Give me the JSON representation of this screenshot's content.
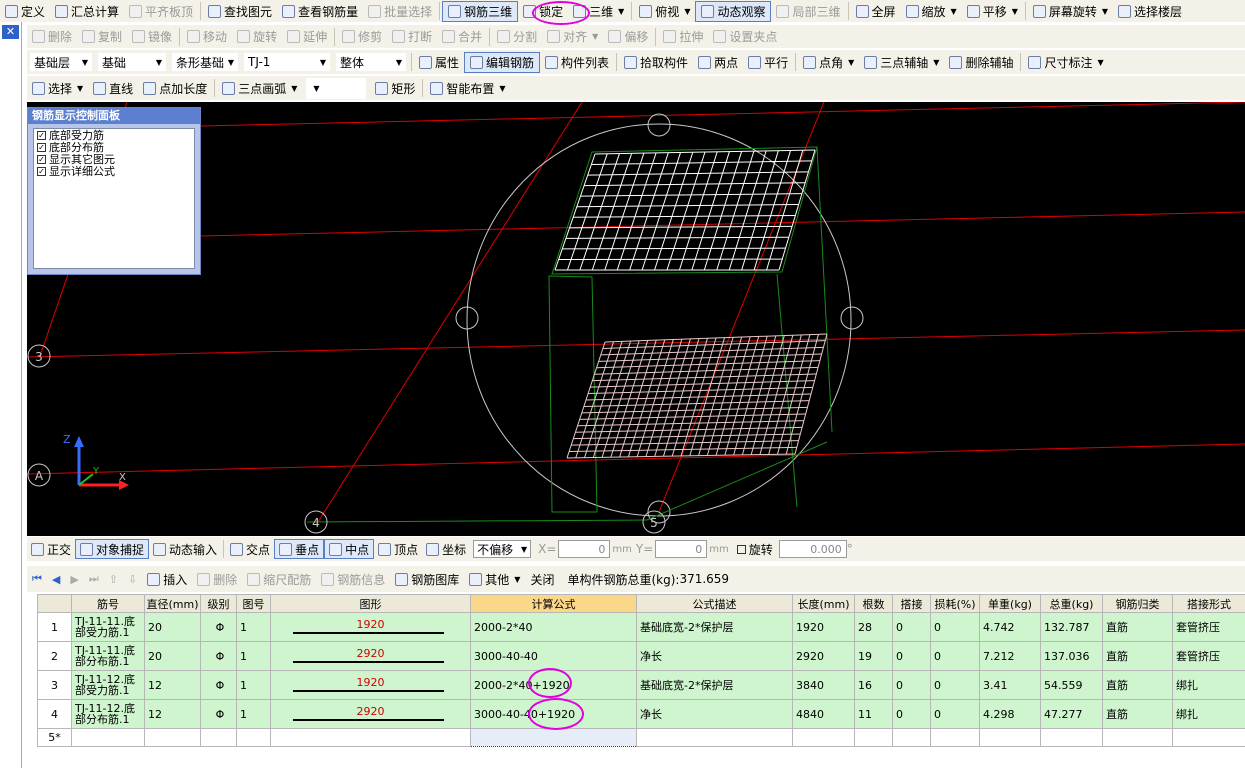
{
  "toolbar1": {
    "items": [
      {
        "label": "定义",
        "icon": "define-icon",
        "disabled": false
      },
      {
        "label": "汇总计算",
        "icon": "sum-icon",
        "disabled": false
      },
      {
        "label": "平齐板顶",
        "icon": "align-slab-icon",
        "disabled": true
      },
      {
        "label": "查找图元",
        "icon": "binoculars-icon",
        "disabled": false
      },
      {
        "label": "查看钢筋量",
        "icon": "view-rebar-icon",
        "disabled": false
      },
      {
        "label": "批量选择",
        "icon": "batch-select-icon",
        "disabled": true
      },
      {
        "label": "钢筋三维",
        "icon": "rebar-3d-icon",
        "disabled": false,
        "active": true
      },
      {
        "label": "锁定",
        "icon": "lock-icon",
        "disabled": false
      },
      {
        "label": "三维",
        "icon": "cube-icon",
        "disabled": false,
        "dropdown": true
      },
      {
        "label": "俯视",
        "icon": "top-view-icon",
        "disabled": false,
        "dropdown": true
      },
      {
        "label": "动态观察",
        "icon": "orbit-icon",
        "disabled": false,
        "active": true
      },
      {
        "label": "局部三维",
        "icon": "local-3d-icon",
        "disabled": true
      },
      {
        "label": "全屏",
        "icon": "fullscreen-icon",
        "disabled": false
      },
      {
        "label": "缩放",
        "icon": "zoom-icon",
        "disabled": false,
        "dropdown": true
      },
      {
        "label": "平移",
        "icon": "pan-icon",
        "disabled": false,
        "dropdown": true
      },
      {
        "label": "屏幕旋转",
        "icon": "screen-rotate-icon",
        "disabled": false,
        "dropdown": true
      },
      {
        "label": "选择楼层",
        "icon": "select-floor-icon",
        "disabled": false
      }
    ]
  },
  "toolbar2": {
    "items": [
      {
        "label": "删除",
        "icon": "delete-icon"
      },
      {
        "label": "复制",
        "icon": "copy-icon"
      },
      {
        "label": "镜像",
        "icon": "mirror-icon"
      },
      {
        "label": "移动",
        "icon": "move-icon"
      },
      {
        "label": "旋转",
        "icon": "rotate-icon"
      },
      {
        "label": "延伸",
        "icon": "extend-icon"
      },
      {
        "label": "修剪",
        "icon": "trim-icon"
      },
      {
        "label": "打断",
        "icon": "break-icon"
      },
      {
        "label": "合并",
        "icon": "merge-icon"
      },
      {
        "label": "分割",
        "icon": "split-icon"
      },
      {
        "label": "对齐",
        "icon": "align-icon",
        "dropdown": true
      },
      {
        "label": "偏移",
        "icon": "offset-icon"
      },
      {
        "label": "拉伸",
        "icon": "stretch-icon"
      },
      {
        "label": "设置夹点",
        "icon": "grip-icon"
      }
    ]
  },
  "toolbar3": {
    "selects": [
      {
        "value": "基础层",
        "width": 62
      },
      {
        "value": "基础",
        "width": 68
      },
      {
        "value": "条形基础",
        "width": 66
      },
      {
        "value": "TJ-1",
        "width": 86
      },
      {
        "value": "整体",
        "width": 70
      }
    ],
    "items": [
      {
        "label": "属性",
        "icon": "properties-icon"
      },
      {
        "label": "编辑钢筋",
        "icon": "edit-rebar-icon",
        "active": true
      },
      {
        "label": "构件列表",
        "icon": "component-list-icon"
      },
      {
        "label": "拾取构件",
        "icon": "pick-icon"
      },
      {
        "label": "两点",
        "icon": "two-point-icon"
      },
      {
        "label": "平行",
        "icon": "parallel-icon"
      },
      {
        "label": "点角",
        "icon": "point-angle-icon",
        "dropdown": true
      },
      {
        "label": "三点辅轴",
        "icon": "three-point-axis-icon",
        "dropdown": true
      },
      {
        "label": "删除辅轴",
        "icon": "delete-axis-icon"
      },
      {
        "label": "尺寸标注",
        "icon": "dimension-icon",
        "dropdown": true
      }
    ]
  },
  "toolbar4": {
    "items": [
      {
        "label": "选择",
        "icon": "cursor-icon",
        "dropdown": true
      },
      {
        "label": "直线",
        "icon": "line-icon"
      },
      {
        "label": "点加长度",
        "icon": "point-length-icon"
      },
      {
        "label": "三点画弧",
        "icon": "arc-icon",
        "dropdown": true
      },
      {
        "label": "",
        "icon": "",
        "dropdown": true,
        "blank": true
      },
      {
        "label": "矩形",
        "icon": "rect-icon"
      },
      {
        "label": "智能布置",
        "icon": "smart-layout-icon",
        "dropdown": true
      }
    ]
  },
  "panel": {
    "title": "钢筋显示控制面板",
    "options": [
      {
        "label": "底部受力筋",
        "checked": true
      },
      {
        "label": "底部分布筋",
        "checked": true
      },
      {
        "label": "显示其它图元",
        "checked": true
      },
      {
        "label": "显示详细公式",
        "checked": true
      }
    ]
  },
  "viewport": {
    "axis_labels": [
      "3",
      "A",
      "4",
      "5"
    ],
    "axis_x": "X",
    "axis_y": "Y",
    "axis_z": "Z",
    "colors": {
      "grid": "#ff0000",
      "guide": "#1a8a1a",
      "rebar_top": "#ffffff",
      "rebar_bottom": "#e8c8c8"
    }
  },
  "snapbar": {
    "items": [
      {
        "label": "正交",
        "icon": "ortho-icon"
      },
      {
        "label": "对象捕捉",
        "icon": "object-snap-icon",
        "active": true
      },
      {
        "label": "动态输入",
        "icon": "dynamic-input-icon"
      },
      {
        "label": "交点",
        "icon": "intersection-icon"
      },
      {
        "label": "垂点",
        "icon": "perpendicular-icon",
        "active": true
      },
      {
        "label": "中点",
        "icon": "midpoint-icon",
        "active": true
      },
      {
        "label": "顶点",
        "icon": "vertex-icon"
      },
      {
        "label": "坐标",
        "icon": "coordinate-icon"
      }
    ],
    "offset_mode": "不偏移",
    "x_label": "X=",
    "x_value": "0",
    "x_unit": "mm",
    "y_label": "Y=",
    "y_value": "0",
    "y_unit": "mm",
    "rotate_label": "旋转",
    "rotate_value": "0.000",
    "rotate_unit": "°"
  },
  "tablebar": {
    "items": [
      {
        "label": "插入",
        "icon": "insert-icon",
        "disabled": false
      },
      {
        "label": "删除",
        "icon": "delete-row-icon",
        "disabled": true
      },
      {
        "label": "缩尺配筋",
        "icon": "scale-rebar-icon",
        "disabled": true
      },
      {
        "label": "钢筋信息",
        "icon": "rebar-info-icon",
        "disabled": true
      },
      {
        "label": "钢筋图库",
        "icon": "rebar-library-icon",
        "disabled": false
      },
      {
        "label": "其他",
        "icon": "other-icon",
        "disabled": false,
        "dropdown": true
      },
      {
        "label": "关闭",
        "icon": "",
        "disabled": false
      }
    ],
    "total_label": "单构件钢筋总重(kg):",
    "total_value": "371.659"
  },
  "table": {
    "columns": [
      "筋号",
      "直径(mm)",
      "级别",
      "图号",
      "图形",
      "计算公式",
      "公式描述",
      "长度(mm)",
      "根数",
      "搭接",
      "损耗(%)",
      "单重(kg)",
      "总重(kg)",
      "钢筋归类",
      "搭接形式"
    ],
    "highlight_column": "计算公式",
    "rows": [
      {
        "n": "1",
        "name_line1": "TJ-11-11.底",
        "name_line2": "部受力筋.1",
        "dia": "20",
        "grade": "Φ",
        "fig": "1",
        "shape_value": "1920",
        "formula": "2000-2*40",
        "desc": "基础底宽-2*保护层",
        "length": "1920",
        "count": "28",
        "lap": "0",
        "loss": "0",
        "unit_w": "4.742",
        "total_w": "132.787",
        "category": "直筋",
        "lap_type": "套管挤压"
      },
      {
        "n": "2",
        "name_line1": "TJ-11-11.底",
        "name_line2": "部分布筋.1",
        "dia": "20",
        "grade": "Φ",
        "fig": "1",
        "shape_value": "2920",
        "formula": "3000-40-40",
        "desc": "净长",
        "length": "2920",
        "count": "19",
        "lap": "0",
        "loss": "0",
        "unit_w": "7.212",
        "total_w": "137.036",
        "category": "直筋",
        "lap_type": "套管挤压"
      },
      {
        "n": "3",
        "name_line1": "TJ-11-12.底",
        "name_line2": "部受力筋.1",
        "dia": "12",
        "grade": "Φ",
        "fig": "1",
        "shape_value": "1920",
        "formula": "2000-2*40+1920",
        "desc": "基础底宽-2*保护层",
        "length": "3840",
        "count": "16",
        "lap": "0",
        "loss": "0",
        "unit_w": "3.41",
        "total_w": "54.559",
        "category": "直筋",
        "lap_type": "绑扎"
      },
      {
        "n": "4",
        "name_line1": "TJ-11-12.底",
        "name_line2": "部分布筋.1",
        "dia": "12",
        "grade": "Φ",
        "fig": "1",
        "shape_value": "2920",
        "formula": "3000-40-40+1920",
        "desc": "净长",
        "length": "4840",
        "count": "11",
        "lap": "0",
        "loss": "0",
        "unit_w": "4.298",
        "total_w": "47.277",
        "category": "直筋",
        "lap_type": "绑扎"
      }
    ],
    "new_row_label": "5*"
  }
}
